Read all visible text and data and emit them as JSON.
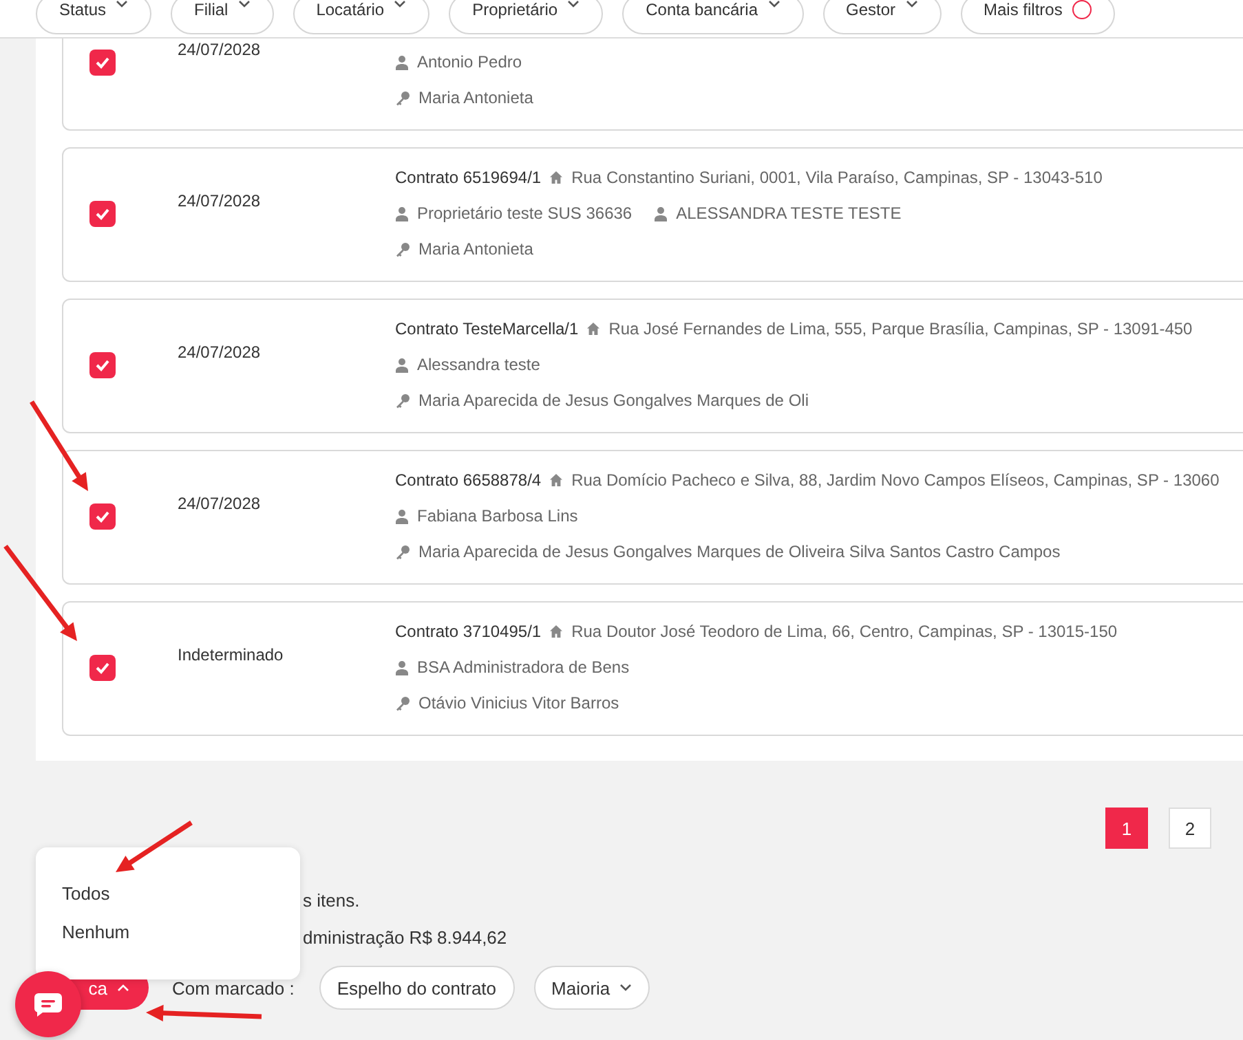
{
  "filters": [
    {
      "label": "Status"
    },
    {
      "label": "Filial"
    },
    {
      "label": "Locatário"
    },
    {
      "label": "Proprietário"
    },
    {
      "label": "Conta bancária"
    },
    {
      "label": "Gestor"
    },
    {
      "label": "Mais filtros",
      "alert": true
    }
  ],
  "contracts": [
    {
      "checked": true,
      "date": "24/07/2028",
      "owners": [
        "Antonio Pedro"
      ],
      "tenants": [
        "Maria Antonieta"
      ]
    },
    {
      "checked": true,
      "date": "24/07/2028",
      "title": "Contrato 6519694/1",
      "address": "Rua Constantino Suriani, 0001, Vila Paraíso, Campinas, SP - 13043-510",
      "owners": [
        "Proprietário teste SUS 36636",
        "ALESSANDRA TESTE TESTE"
      ],
      "tenants": [
        "Maria Antonieta"
      ]
    },
    {
      "checked": true,
      "date": "24/07/2028",
      "title": "Contrato TesteMarcella/1",
      "address": "Rua José Fernandes de Lima, 555, Parque Brasília, Campinas, SP - 13091-450",
      "owners": [
        "Alessandra teste"
      ],
      "tenants": [
        "Maria Aparecida de Jesus Gongalves Marques de Oli"
      ]
    },
    {
      "checked": true,
      "date": "24/07/2028",
      "title": "Contrato 6658878/4",
      "address": "Rua Domício Pacheco e Silva, 88, Jardim Novo Campos Elíseos, Campinas, SP - 13060",
      "owners": [
        "Fabiana Barbosa Lins"
      ],
      "tenants": [
        "Maria Aparecida de Jesus Gongalves Marques de Oliveira Silva Santos Castro Campos"
      ]
    },
    {
      "checked": true,
      "date": "Indeterminado",
      "title": "Contrato 3710495/1",
      "address": "Rua Doutor José Teodoro de Lima, 66, Centro, Campinas, SP - 13015-150",
      "owners": [
        "BSA Administradora de Bens"
      ],
      "tenants": [
        "Otávio Vinicius Vitor Barros"
      ]
    }
  ],
  "pagination": [
    {
      "label": "1",
      "selected": true
    },
    {
      "label": "2",
      "selected": false
    }
  ],
  "summary": [
    "s itens.",
    "dministração R$ 8.944,62"
  ],
  "select_menu": {
    "items": [
      "Todos",
      "Nenhum"
    ]
  },
  "bottom_bar": {
    "select_button": "ca",
    "with_checked_label": "Com marcado :",
    "actions": [
      {
        "label": "Espelho do contrato",
        "dropdown": false
      },
      {
        "label": "Maioria",
        "dropdown": true
      }
    ]
  }
}
